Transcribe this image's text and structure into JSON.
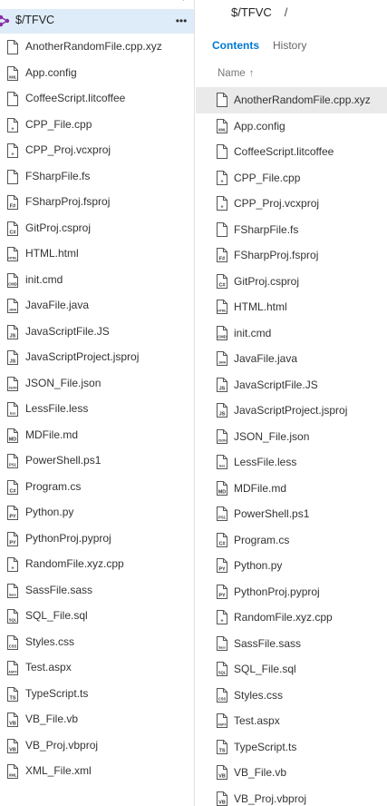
{
  "tree": {
    "root_label": "$/TFVC",
    "more_label": "•••",
    "files": [
      {
        "name": "AnotherRandomFile.cpp.xyz",
        "icon": "generic-file-icon",
        "tag": ""
      },
      {
        "name": "App.config",
        "icon": "xml-file-icon",
        "tag": "XML"
      },
      {
        "name": "CoffeeScript.litcoffee",
        "icon": "generic-file-icon",
        "tag": ""
      },
      {
        "name": "CPP_File.cpp",
        "icon": "cpp-file-icon",
        "tag": "+"
      },
      {
        "name": "CPP_Proj.vcxproj",
        "icon": "cpp-project-icon",
        "tag": "+"
      },
      {
        "name": "FSharpFile.fs",
        "icon": "generic-file-icon",
        "tag": ""
      },
      {
        "name": "FSharpProj.fsproj",
        "icon": "fsharp-project-icon",
        "tag": "F#"
      },
      {
        "name": "GitProj.csproj",
        "icon": "csharp-project-icon",
        "tag": "C#"
      },
      {
        "name": "HTML.html",
        "icon": "html-file-icon",
        "tag": "HTML"
      },
      {
        "name": "init.cmd",
        "icon": "cmd-file-icon",
        "tag": "CMD"
      },
      {
        "name": "JavaFile.java",
        "icon": "java-file-icon",
        "tag": "JAVA"
      },
      {
        "name": "JavaScriptFile.JS",
        "icon": "js-file-icon",
        "tag": "JS"
      },
      {
        "name": "JavaScriptProject.jsproj",
        "icon": "js-project-icon",
        "tag": "JS"
      },
      {
        "name": "JSON_File.json",
        "icon": "json-file-icon",
        "tag": "JSON"
      },
      {
        "name": "LessFile.less",
        "icon": "less-file-icon",
        "tag": "less"
      },
      {
        "name": "MDFile.md",
        "icon": "md-file-icon",
        "tag": "MD"
      },
      {
        "name": "PowerShell.ps1",
        "icon": "ps-file-icon",
        "tag": "PS1"
      },
      {
        "name": "Program.cs",
        "icon": "cs-file-icon",
        "tag": "C#"
      },
      {
        "name": "Python.py",
        "icon": "py-file-icon",
        "tag": "PY"
      },
      {
        "name": "PythonProj.pyproj",
        "icon": "py-project-icon",
        "tag": "PY"
      },
      {
        "name": "RandomFile.xyz.cpp",
        "icon": "cpp-file-icon",
        "tag": "+"
      },
      {
        "name": "SassFile.sass",
        "icon": "sass-file-icon",
        "tag": "Sass"
      },
      {
        "name": "SQL_File.sql",
        "icon": "sql-file-icon",
        "tag": "SQL"
      },
      {
        "name": "Styles.css",
        "icon": "css-file-icon",
        "tag": "CSS"
      },
      {
        "name": "Test.aspx",
        "icon": "aspx-file-icon",
        "tag": "ASPX"
      },
      {
        "name": "TypeScript.ts",
        "icon": "ts-file-icon",
        "tag": "TS"
      },
      {
        "name": "VB_File.vb",
        "icon": "vb-file-icon",
        "tag": "VB"
      },
      {
        "name": "VB_Proj.vbproj",
        "icon": "vb-project-icon",
        "tag": "VB"
      },
      {
        "name": "XML_File.xml",
        "icon": "xml-file-icon",
        "tag": "XML"
      }
    ]
  },
  "content": {
    "breadcrumb_path": "$/TFVC",
    "breadcrumb_sep": "/",
    "tabs": {
      "contents": "Contents",
      "history": "History"
    },
    "column_name": "Name",
    "sort_arrow": "↑",
    "selected_index": 0
  },
  "colors": {
    "accent": "#0078d4",
    "root_selection": "#deecf9",
    "row_selection": "#eaeaea",
    "root_icon": "#8a2da5"
  }
}
